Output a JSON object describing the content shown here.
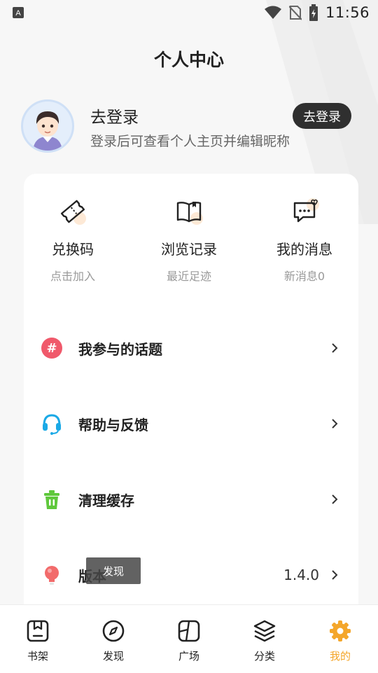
{
  "status_bar": {
    "time": "11:56"
  },
  "header": {
    "title": "个人中心"
  },
  "profile": {
    "name": "去登录",
    "subtitle": "登录后可查看个人主页并编辑昵称",
    "login_button": "去登录"
  },
  "quick_actions": [
    {
      "label": "兑换码",
      "sub": "点击加入",
      "icon": "ticket-icon"
    },
    {
      "label": "浏览记录",
      "sub": "最近足迹",
      "icon": "book-icon"
    },
    {
      "label": "我的消息",
      "sub": "新消息0",
      "icon": "message-heart-icon"
    }
  ],
  "menu": [
    {
      "label": "我参与的话题",
      "icon": "hashtag-icon",
      "value": ""
    },
    {
      "label": "帮助与反馈",
      "icon": "headset-icon",
      "value": ""
    },
    {
      "label": "清理缓存",
      "icon": "trash-icon",
      "value": ""
    },
    {
      "label": "版本",
      "icon": "lightbulb-icon",
      "value": "1.4.0"
    }
  ],
  "toast": {
    "text": "发现"
  },
  "tabbar": [
    {
      "label": "书架",
      "icon": "bookshelf-icon"
    },
    {
      "label": "发现",
      "icon": "compass-icon"
    },
    {
      "label": "广场",
      "icon": "square-icon"
    },
    {
      "label": "分类",
      "icon": "layers-icon"
    },
    {
      "label": "我的",
      "icon": "gear-icon",
      "active": true
    }
  ],
  "colors": {
    "accent": "#f4a62a",
    "dark_button": "#2f2f2f",
    "hashtag": "#f0596b",
    "headset": "#1aa9e6",
    "trash": "#5fc83c",
    "bulb": "#f26b6b"
  }
}
